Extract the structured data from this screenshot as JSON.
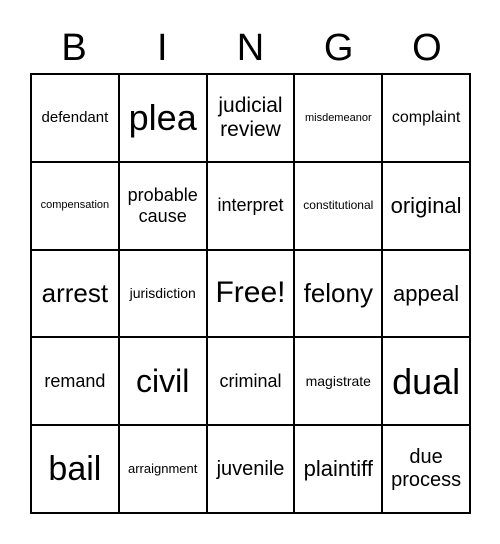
{
  "header": [
    "B",
    "I",
    "N",
    "G",
    "O"
  ],
  "cells": [
    "defendant",
    "plea",
    "judicial review",
    "misdemeanor",
    "complaint",
    "compensation",
    "probable cause",
    "interpret",
    "constitutional",
    "original",
    "arrest",
    "jurisdiction",
    "Free!",
    "felony",
    "appeal",
    "remand",
    "civil",
    "criminal",
    "magistrate",
    "dual",
    "bail",
    "arraignment",
    "juvenile",
    "plaintiff",
    "due process"
  ]
}
